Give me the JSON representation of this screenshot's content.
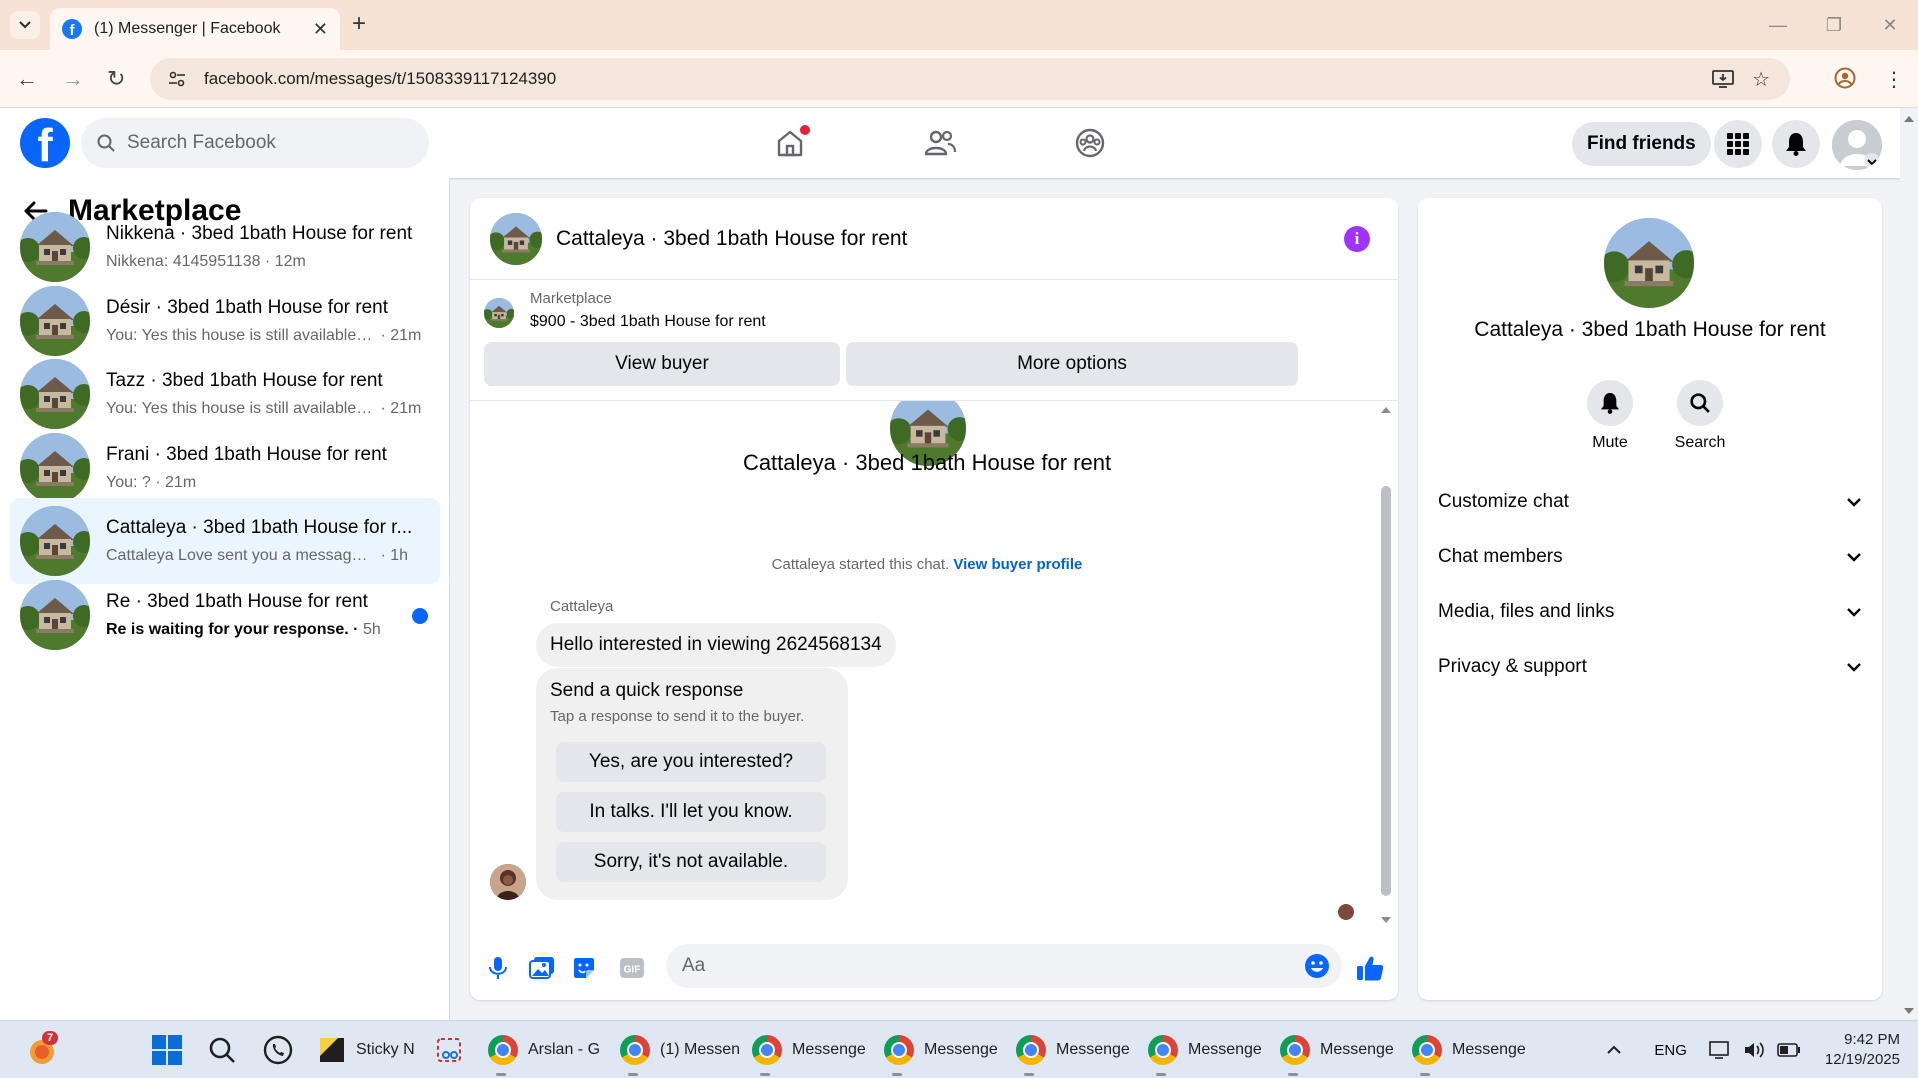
{
  "browser": {
    "tab_title": "(1) Messenger | Facebook",
    "url": "facebook.com/messages/t/1508339117124390"
  },
  "fb_header": {
    "search_placeholder": "Search Facebook",
    "find_friends_label": "Find friends"
  },
  "left_panel": {
    "title": "Marketplace",
    "conversations": [
      {
        "name": "Nikkena · 3bed 1bath House for rent",
        "snippet": "Nikkena: 4145951138",
        "time": "12m",
        "unread": false,
        "active": false
      },
      {
        "name": "Désir · 3bed 1bath House for rent",
        "snippet": "You: Yes this house is still available f...",
        "time": "21m",
        "unread": false,
        "active": false
      },
      {
        "name": "Tazz · 3bed 1bath House for rent",
        "snippet": "You: Yes this house is still available f...",
        "time": "21m",
        "unread": false,
        "active": false
      },
      {
        "name": "Frani · 3bed 1bath House for rent",
        "snippet": "You: ?",
        "time": "21m",
        "unread": false,
        "active": false
      },
      {
        "name": "Cattaleya · 3bed 1bath House for r...",
        "snippet": "Cattaleya Love sent you a message ab...",
        "time": "1h",
        "unread": false,
        "active": true
      },
      {
        "name": "Re · 3bed 1bath House for rent",
        "snippet": "Re is waiting for your response.",
        "time": "5h",
        "unread": true,
        "active": false
      }
    ]
  },
  "chat": {
    "title": "Cattaleya · 3bed 1bath House for rent",
    "listing_label": "Marketplace",
    "listing_price_title": "$900 - 3bed 1bath House for rent",
    "view_buyer_label": "View buyer",
    "more_options_label": "More options",
    "intro_name": "Cattaleya · 3bed 1bath House for rent",
    "started_text": "Cattaleya started this chat.",
    "view_buyer_profile_label": "View buyer profile",
    "sender_name": "Cattaleya",
    "message": "Hello interested in viewing 2624568134",
    "quick_response_title": "Send a quick response",
    "quick_response_sub": "Tap a response to send it to the buyer.",
    "quick_responses": [
      "Yes, are you interested?",
      "In talks. I'll let you know.",
      "Sorry, it's not available."
    ],
    "composer_placeholder": "Aa"
  },
  "info_panel": {
    "name": "Cattaleya · 3bed 1bath House for rent",
    "mute_label": "Mute",
    "search_label": "Search",
    "sections": [
      "Customize chat",
      "Chat members",
      "Media, files and links",
      "Privacy & support"
    ]
  },
  "taskbar": {
    "badge_count": "7",
    "sticky_label": "Sticky N",
    "apps": [
      "Arslan - G",
      "(1) Messen",
      "Messenge",
      "Messenge",
      "Messenge",
      "Messenge",
      "Messenge",
      "Messenge"
    ],
    "language": "ENG",
    "time": "9:42 PM",
    "date": "12/19/2025"
  },
  "colors": {
    "facebook_blue": "#0866ff",
    "active_conversation_bg": "#ebf5ff",
    "info_purple": "#a033ff",
    "link_blue": "#0064d1"
  },
  "icons": [
    "tab-search-icon",
    "facebook-favicon",
    "close-icon",
    "new-tab-icon",
    "back-arrow-icon",
    "forward-arrow-icon",
    "reload-icon",
    "site-settings-icon",
    "install-icon",
    "star-icon",
    "profile-icon",
    "kebab-menu-icon",
    "search-icon",
    "home-icon",
    "friends-icon",
    "groups-icon",
    "grid-menu-icon",
    "bell-icon",
    "info-icon",
    "microphone-icon",
    "photo-icon",
    "sticker-icon",
    "gif-icon",
    "emoji-icon",
    "thumbs-up-icon",
    "chevron-down-icon"
  ]
}
